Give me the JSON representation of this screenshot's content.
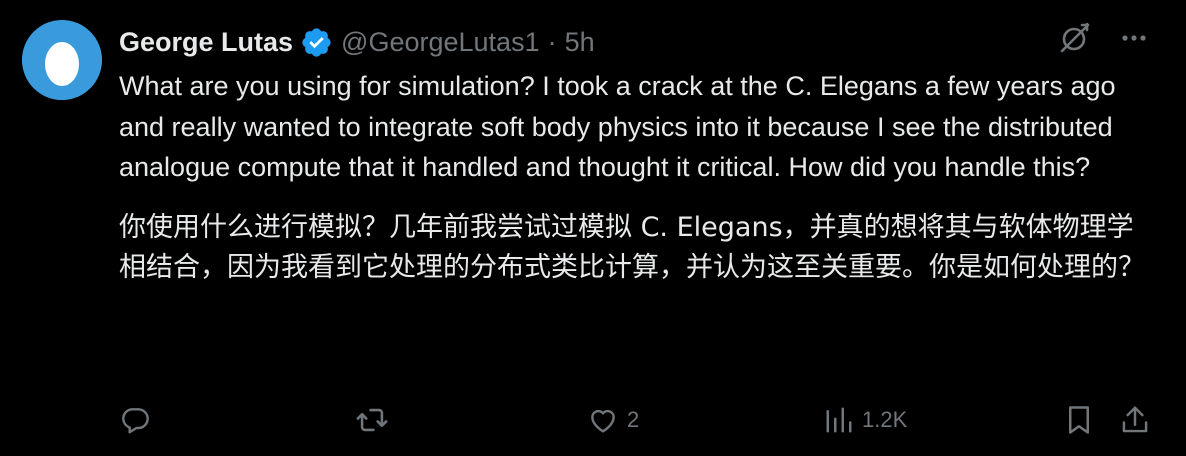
{
  "author": {
    "name": "George Lutas",
    "handle": "@GeorgeLutas1",
    "separator": "·",
    "time": "5h",
    "avatar_icon": "egg-avatar-icon",
    "verified_icon": "verified-badge-icon"
  },
  "tweet": {
    "text_en": "What are you using for simulation? I took a crack at the C. Elegans a few years ago and really wanted to integrate soft body physics into it because I see the distributed analogue compute that it handled and thought it critical. How did you handle this?",
    "text_cn": "你使用什么进行模拟？几年前我尝试过模拟 C. Elegans，并真的想将其与软体物理学相结合，因为我看到它处理的分布式类比计算，并认为这至关重要。你是如何处理的？"
  },
  "top_actions": [
    {
      "icon": "grok-icon"
    },
    {
      "icon": "more-icon"
    }
  ],
  "actions": {
    "reply": {
      "icon": "reply-icon",
      "count": ""
    },
    "retweet": {
      "icon": "retweet-icon",
      "count": ""
    },
    "like": {
      "icon": "heart-icon",
      "count": "2"
    },
    "views": {
      "icon": "views-icon",
      "count": "1.2K"
    },
    "bookmark": {
      "icon": "bookmark-icon"
    },
    "share": {
      "icon": "share-icon"
    }
  },
  "colors": {
    "background": "#000000",
    "text": "#e7e9ea",
    "secondary": "#71767b",
    "verified": "#1d9bf0",
    "avatar_bg": "#3a9bdc"
  }
}
